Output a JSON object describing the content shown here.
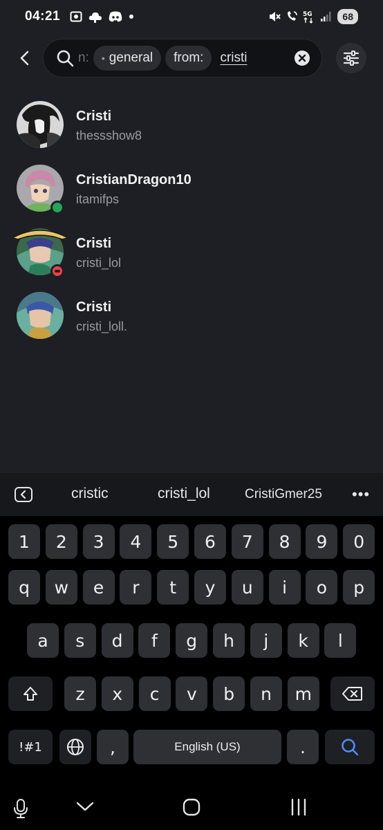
{
  "status_bar": {
    "time": "04:21",
    "battery": "68"
  },
  "search": {
    "faded_chip_text": "n:",
    "channel_chip": "general",
    "from_chip": "from:",
    "query": "cristi"
  },
  "results": [
    {
      "name": "Cristi",
      "username": "thessshow8",
      "status": "none"
    },
    {
      "name": "CristianDragon10",
      "username": "itamifps",
      "status": "online"
    },
    {
      "name": "Cristi",
      "username": "cristi_lol",
      "status": "dnd"
    },
    {
      "name": "Cristi",
      "username": "cristi_loll.",
      "status": "none"
    }
  ],
  "keyboard": {
    "suggestions": [
      "cristic",
      "cristi_lol",
      "CristiGmer25"
    ],
    "more": "•••",
    "row_numbers": [
      "1",
      "2",
      "3",
      "4",
      "5",
      "6",
      "7",
      "8",
      "9",
      "0"
    ],
    "row1": [
      "q",
      "w",
      "e",
      "r",
      "t",
      "y",
      "u",
      "i",
      "o",
      "p"
    ],
    "row2": [
      "a",
      "s",
      "d",
      "f",
      "g",
      "h",
      "j",
      "k",
      "l"
    ],
    "row3": [
      "z",
      "x",
      "c",
      "v",
      "b",
      "n",
      "m"
    ],
    "symbols_key": "!#1",
    "comma_key": ",",
    "space_key": "English (US)",
    "period_key": "."
  },
  "colors": {
    "online": "#23a55a",
    "dnd": "#f23f43",
    "background": "#1e1f24",
    "accent_search": "#4c8dff"
  }
}
